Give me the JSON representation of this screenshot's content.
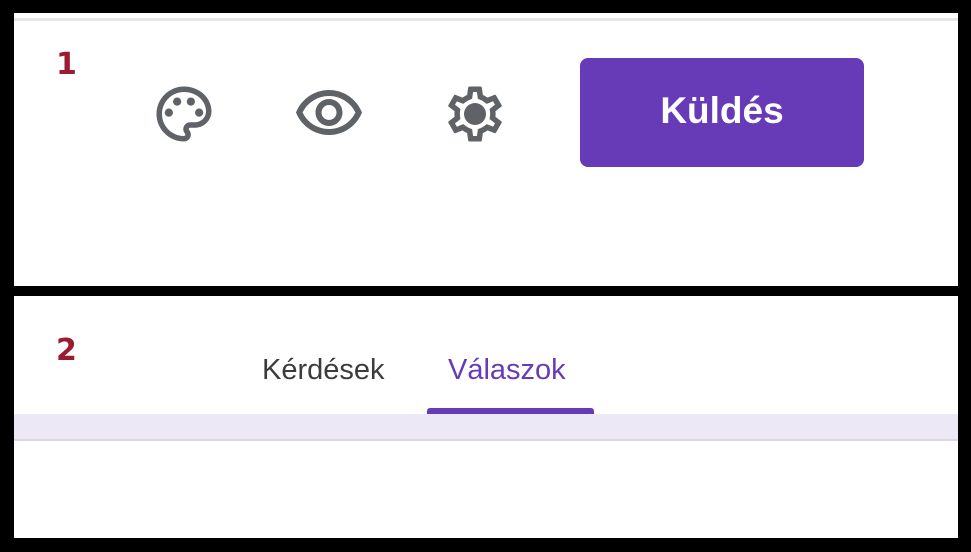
{
  "panel1": {
    "step": "1",
    "toolbar": {
      "icons": [
        "palette-icon",
        "eye-icon",
        "gear-icon"
      ],
      "send_label": "Küldés",
      "accent": "#673ab7",
      "icon_color": "#5f6368"
    }
  },
  "panel2": {
    "step": "2",
    "tabs": [
      {
        "label": "Kérdések",
        "active": false
      },
      {
        "label": "Válaszok",
        "active": true
      }
    ]
  },
  "colors": {
    "step_number": "#9b1b30",
    "tab_strip": "#ece8f5"
  }
}
